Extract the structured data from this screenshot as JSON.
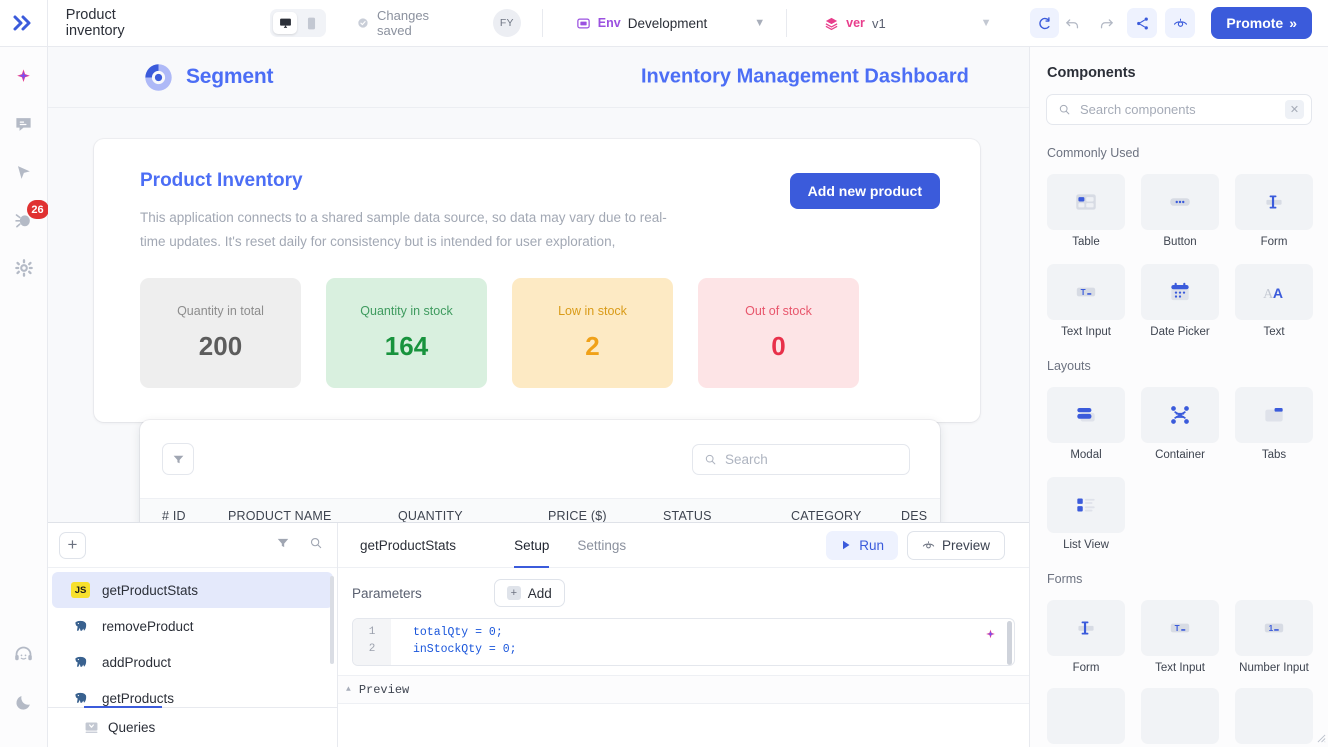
{
  "topbar": {
    "logo_icon": "chevrons-right-icon",
    "app_title": "Product inventory",
    "device_desktop_icon": "desktop-icon",
    "device_mobile_icon": "mobile-icon",
    "saved_icon": "cloud-check-icon",
    "saved_text": "Changes saved",
    "avatar_initials": "FY",
    "env_icon": "env-box-icon",
    "env_key": "Env",
    "env_value": "Development",
    "env_chevron_icon": "chevron-down-icon",
    "version_icon": "layers-icon",
    "version_key": "ver",
    "version_value": "v1",
    "version_chevron_icon": "chevron-down-icon",
    "refresh_icon": "refresh-icon",
    "undo_icon": "undo-icon",
    "redo_icon": "redo-icon",
    "share_icon": "share-icon",
    "preview_eye_icon": "eye-icon",
    "promote_label": "Promote",
    "promote_chevrons": "»"
  },
  "rail": {
    "items": [
      {
        "icon": "magic-sparkle-icon",
        "badge": null
      },
      {
        "icon": "code-comment-icon",
        "badge": null
      },
      {
        "icon": "cursor-pointer-icon",
        "badge": null
      },
      {
        "icon": "bug-icon",
        "badge": "26"
      },
      {
        "icon": "gear-icon",
        "badge": null
      }
    ],
    "bottom_items": [
      {
        "icon": "headset-support-icon"
      },
      {
        "icon": "moon-dark-mode-icon"
      }
    ]
  },
  "canvas": {
    "brand_logo_icon": "segment-donut-icon",
    "brand_name": "Segment",
    "dashboard_title": "Inventory Management Dashboard",
    "panel": {
      "title": "Product Inventory",
      "description": "This application connects to a shared sample data source, so data may vary due to real-time updates. It's reset daily for consistency but is intended for user exploration,",
      "add_button_label": "Add new product"
    },
    "stats": [
      {
        "label": "Quantity in total",
        "value": "200",
        "variant": "total"
      },
      {
        "label": "Quantity in stock",
        "value": "164",
        "variant": "instock"
      },
      {
        "label": "Low in stock",
        "value": "2",
        "variant": "low"
      },
      {
        "label": "Out of stock",
        "value": "0",
        "variant": "out"
      }
    ],
    "table": {
      "filter_icon": "filter-icon",
      "search_icon": "search-icon",
      "search_placeholder": "Search",
      "columns": [
        "# ID",
        "PRODUCT NAME",
        "QUANTITY",
        "PRICE ($)",
        "STATUS",
        "CATEGORY",
        "DES"
      ]
    }
  },
  "bottom_panel": {
    "add_query_icon": "plus-icon",
    "filter_icon": "filter-icon",
    "search_icon": "search-icon",
    "queries": [
      {
        "name": "getProductStats",
        "type": "js",
        "type_label": "JS",
        "active": true
      },
      {
        "name": "removeProduct",
        "type": "postgres",
        "type_label": "",
        "active": false
      },
      {
        "name": "addProduct",
        "type": "postgres",
        "type_label": "",
        "active": false
      },
      {
        "name": "getProducts",
        "type": "postgres",
        "type_label": "",
        "active": false
      }
    ],
    "footer_tab_icon": "queries-panel-icon",
    "footer_tab_label": "Queries",
    "editor": {
      "query_name": "getProductStats",
      "tabs": [
        {
          "label": "Setup",
          "active": true
        },
        {
          "label": "Settings",
          "active": false
        }
      ],
      "run_icon": "play-icon",
      "run_label": "Run",
      "preview_icon": "eye-icon",
      "preview_label": "Preview",
      "params_label": "Parameters",
      "add_param_label": "Add",
      "code_lines": [
        {
          "number": "1",
          "text": "totalQty = 0;"
        },
        {
          "number": "2",
          "text": "inStockQty = 0;"
        }
      ],
      "code_badge_icon": "magic-sparkle-icon",
      "preview_toggle_icon": "triangle-up-icon",
      "preview_section_label": "Preview"
    }
  },
  "right_panel": {
    "title": "Components",
    "search_icon": "search-icon",
    "search_placeholder": "Search components",
    "search_clear_icon": "close-icon",
    "groups": [
      {
        "label": "Commonly Used",
        "items": [
          {
            "label": "Table",
            "icon": "table-icon"
          },
          {
            "label": "Button",
            "icon": "button-icon"
          },
          {
            "label": "Form",
            "icon": "form-icon"
          },
          {
            "label": "Text Input",
            "icon": "text-input-icon"
          },
          {
            "label": "Date Picker",
            "icon": "calendar-icon"
          },
          {
            "label": "Text",
            "icon": "text-icon"
          }
        ]
      },
      {
        "label": "Layouts",
        "items": [
          {
            "label": "Modal",
            "icon": "modal-icon"
          },
          {
            "label": "Container",
            "icon": "container-icon"
          },
          {
            "label": "Tabs",
            "icon": "tabs-icon"
          },
          {
            "label": "List View",
            "icon": "list-view-icon"
          }
        ]
      },
      {
        "label": "Forms",
        "items": [
          {
            "label": "Form",
            "icon": "form-icon"
          },
          {
            "label": "Text Input",
            "icon": "text-input-icon"
          },
          {
            "label": "Number Input",
            "icon": "number-input-icon"
          }
        ]
      }
    ],
    "resize_grip_icon": "resize-grip-icon"
  },
  "colors": {
    "accent": "#3b5bdb",
    "brand": "#4c6ef5",
    "env_purple": "#9b51e0",
    "ver_pink": "#e83e8c",
    "badge_red": "#e03131",
    "stat_green": "#18933d",
    "stat_amber": "#f0a118",
    "stat_red": "#e8304a"
  }
}
